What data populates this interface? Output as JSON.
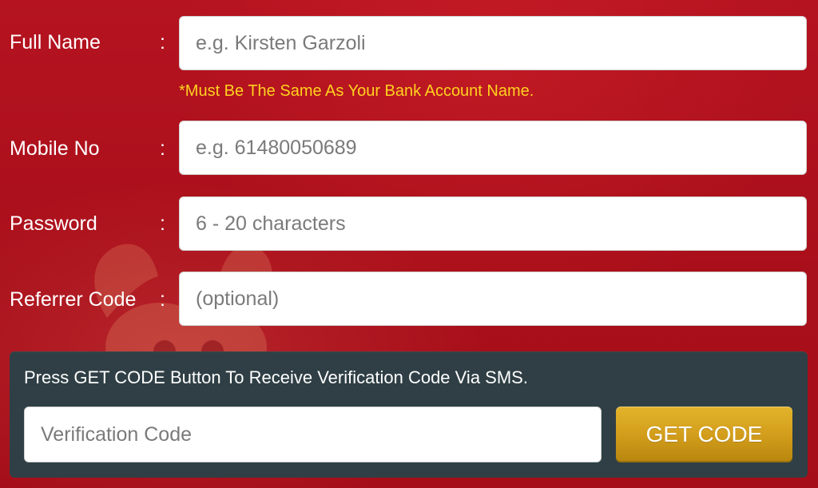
{
  "form": {
    "full_name": {
      "label": "Full Name",
      "colon": ":",
      "placeholder": "e.g. Kirsten Garzoli",
      "note": "*Must Be The Same As Your Bank Account Name."
    },
    "mobile": {
      "label": "Mobile No",
      "colon": ":",
      "placeholder": "e.g. 61480050689"
    },
    "password": {
      "label": "Password",
      "colon": ":",
      "placeholder": "6 - 20 characters"
    },
    "referrer": {
      "label": "Referrer Code",
      "colon": ":",
      "placeholder": "(optional)"
    }
  },
  "verification": {
    "instruction": "Press GET CODE Button To Receive Verification Code Via SMS.",
    "placeholder": "Verification Code",
    "button_label": "GET CODE"
  },
  "colors": {
    "background": "#b0121b",
    "note": "#ffd21f",
    "panel": "#2f3f45",
    "button": "#d29d1b"
  }
}
